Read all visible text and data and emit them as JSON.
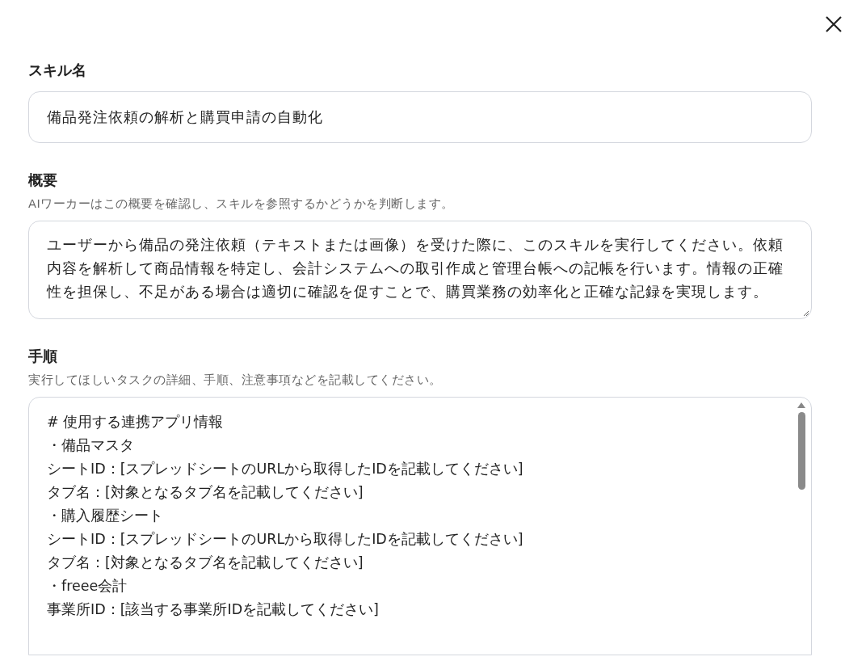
{
  "skill_name": {
    "label": "スキル名",
    "value": "備品発注依頼の解析と購買申請の自動化"
  },
  "summary": {
    "label": "概要",
    "hint": "AIワーカーはこの概要を確認し、スキルを参照するかどうかを判断します。",
    "value": "ユーザーから備品の発注依頼（テキストまたは画像）を受けた際に、このスキルを実行してください。依頼内容を解析して商品情報を特定し、会計システムへの取引作成と管理台帳への記帳を行います。情報の正確性を担保し、不足がある場合は適切に確認を促すことで、購買業務の効率化と正確な記録を実現します。"
  },
  "instructions": {
    "label": "手順",
    "hint": "実行してほしいタスクの詳細、手順、注意事項などを記載してください。",
    "lines": [
      "# 使用する連携アプリ情報",
      "・備品マスタ",
      "シートID：[スプレッドシートのURLから取得したIDを記載してください]",
      "タブ名：[対象となるタブ名を記載してください]",
      "・購入履歴シート",
      "シートID：[スプレッドシートのURLから取得したIDを記載してください]",
      "タブ名：[対象となるタブ名を記載してください]",
      "・freee会計",
      "事業所ID：[該当する事業所IDを記載してください]"
    ]
  }
}
